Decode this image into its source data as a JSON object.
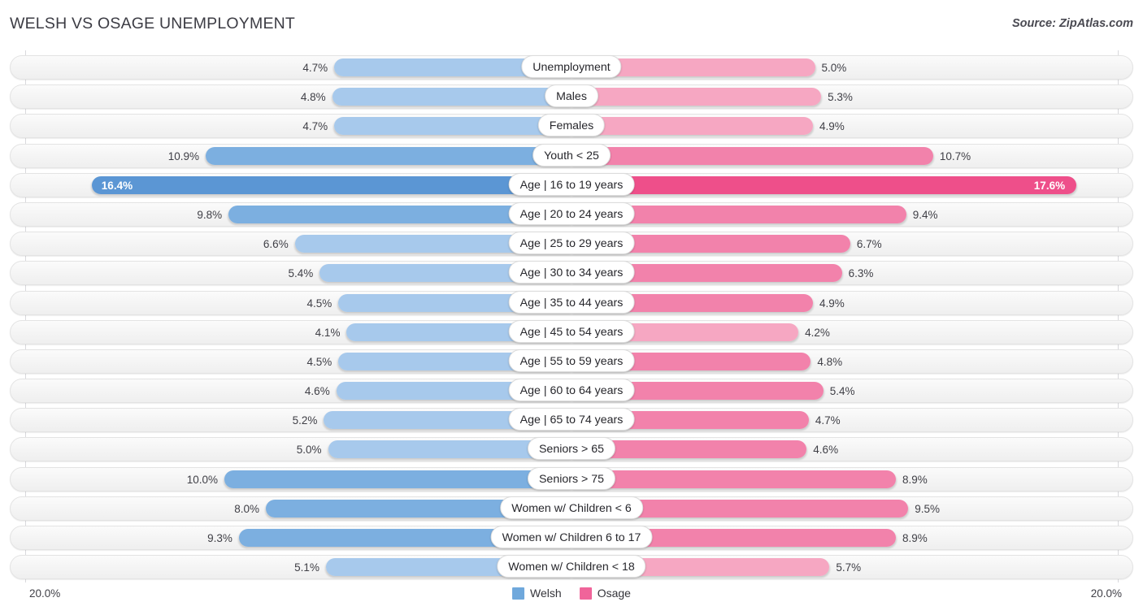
{
  "header": {
    "title": "WELSH VS OSAGE UNEMPLOYMENT",
    "source": "Source: ZipAtlas.com"
  },
  "axis": {
    "min_label": "20.0%",
    "max_label": "20.0%"
  },
  "legend": {
    "items": [
      {
        "label": "Welsh",
        "color": "#6fa8dc"
      },
      {
        "label": "Osage",
        "color": "#f0649a"
      }
    ]
  },
  "colors": {
    "welsh_light": "#a7c9ec",
    "welsh_mid": "#7cafe0",
    "welsh_dark": "#5b96d4",
    "osage_light": "#f6a7c2",
    "osage_mid": "#f282ab",
    "osage_dark": "#ee4f8a",
    "text": "#3f3f46"
  },
  "chart_data": {
    "type": "bar",
    "orientation": "horizontal-diverging",
    "title": "WELSH VS OSAGE UNEMPLOYMENT",
    "xlabel": "",
    "ylabel": "",
    "xlim": [
      20.0,
      20.0
    ],
    "grid": true,
    "legend_position": "bottom-center",
    "categories": [
      "Unemployment",
      "Males",
      "Females",
      "Youth < 25",
      "Age | 16 to 19 years",
      "Age | 20 to 24 years",
      "Age | 25 to 29 years",
      "Age | 30 to 34 years",
      "Age | 35 to 44 years",
      "Age | 45 to 54 years",
      "Age | 55 to 59 years",
      "Age | 60 to 64 years",
      "Age | 65 to 74 years",
      "Seniors > 65",
      "Seniors > 75",
      "Women w/ Children < 6",
      "Women w/ Children 6 to 17",
      "Women w/ Children < 18"
    ],
    "series": [
      {
        "name": "Welsh",
        "values": [
          4.7,
          4.8,
          4.7,
          10.9,
          16.4,
          9.8,
          6.6,
          5.4,
          4.5,
          4.1,
          4.5,
          4.6,
          5.2,
          5.0,
          10.0,
          8.0,
          9.3,
          5.1
        ]
      },
      {
        "name": "Osage",
        "values": [
          5.0,
          5.3,
          4.9,
          10.7,
          17.6,
          9.4,
          6.7,
          6.3,
          4.9,
          4.2,
          4.8,
          5.4,
          4.7,
          4.6,
          8.9,
          9.5,
          8.9,
          5.7
        ]
      }
    ]
  },
  "rows": [
    {
      "label": "Unemployment",
      "left": "4.7%",
      "right": "5.0%",
      "lv": 4.7,
      "rv": 5.0,
      "lshade": "light",
      "rshade": "light"
    },
    {
      "label": "Males",
      "left": "4.8%",
      "right": "5.3%",
      "lv": 4.8,
      "rv": 5.3,
      "lshade": "light",
      "rshade": "light"
    },
    {
      "label": "Females",
      "left": "4.7%",
      "right": "4.9%",
      "lv": 4.7,
      "rv": 4.9,
      "lshade": "light",
      "rshade": "light"
    },
    {
      "label": "Youth < 25",
      "left": "10.9%",
      "right": "10.7%",
      "lv": 10.9,
      "rv": 10.7,
      "lshade": "mid",
      "rshade": "mid"
    },
    {
      "label": "Age | 16 to 19 years",
      "left": "16.4%",
      "right": "17.6%",
      "lv": 16.4,
      "rv": 17.6,
      "lshade": "dark",
      "rshade": "dark",
      "inside": true
    },
    {
      "label": "Age | 20 to 24 years",
      "left": "9.8%",
      "right": "9.4%",
      "lv": 9.8,
      "rv": 9.4,
      "lshade": "mid",
      "rshade": "mid"
    },
    {
      "label": "Age | 25 to 29 years",
      "left": "6.6%",
      "right": "6.7%",
      "lv": 6.6,
      "rv": 6.7,
      "lshade": "light",
      "rshade": "mid"
    },
    {
      "label": "Age | 30 to 34 years",
      "left": "5.4%",
      "right": "6.3%",
      "lv": 5.4,
      "rv": 6.3,
      "lshade": "light",
      "rshade": "mid"
    },
    {
      "label": "Age | 35 to 44 years",
      "left": "4.5%",
      "right": "4.9%",
      "lv": 4.5,
      "rv": 4.9,
      "lshade": "light",
      "rshade": "mid"
    },
    {
      "label": "Age | 45 to 54 years",
      "left": "4.1%",
      "right": "4.2%",
      "lv": 4.1,
      "rv": 4.2,
      "lshade": "light",
      "rshade": "light"
    },
    {
      "label": "Age | 55 to 59 years",
      "left": "4.5%",
      "right": "4.8%",
      "lv": 4.5,
      "rv": 4.8,
      "lshade": "light",
      "rshade": "mid"
    },
    {
      "label": "Age | 60 to 64 years",
      "left": "4.6%",
      "right": "5.4%",
      "lv": 4.6,
      "rv": 5.4,
      "lshade": "light",
      "rshade": "mid"
    },
    {
      "label": "Age | 65 to 74 years",
      "left": "5.2%",
      "right": "4.7%",
      "lv": 5.2,
      "rv": 4.7,
      "lshade": "light",
      "rshade": "mid"
    },
    {
      "label": "Seniors > 65",
      "left": "5.0%",
      "right": "4.6%",
      "lv": 5.0,
      "rv": 4.6,
      "lshade": "light",
      "rshade": "mid"
    },
    {
      "label": "Seniors > 75",
      "left": "10.0%",
      "right": "8.9%",
      "lv": 10.0,
      "rv": 8.9,
      "lshade": "mid",
      "rshade": "mid"
    },
    {
      "label": "Women w/ Children < 6",
      "left": "8.0%",
      "right": "9.5%",
      "lv": 8.0,
      "rv": 9.5,
      "lshade": "mid",
      "rshade": "mid"
    },
    {
      "label": "Women w/ Children 6 to 17",
      "left": "9.3%",
      "right": "8.9%",
      "lv": 9.3,
      "rv": 8.9,
      "lshade": "mid",
      "rshade": "mid"
    },
    {
      "label": "Women w/ Children < 18",
      "left": "5.1%",
      "right": "5.7%",
      "lv": 5.1,
      "rv": 5.7,
      "lshade": "light",
      "rshade": "light"
    }
  ]
}
